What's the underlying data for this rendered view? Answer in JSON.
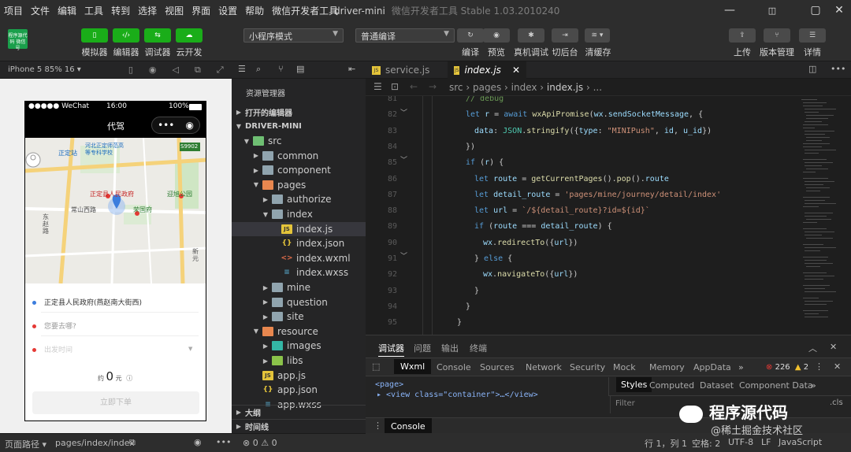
{
  "menu": [
    "项目",
    "文件",
    "编辑",
    "工具",
    "转到",
    "选择",
    "视图",
    "界面",
    "设置",
    "帮助",
    "微信开发者工具"
  ],
  "window": {
    "title": "driver-mini",
    "subtitle": "微信开发者工具 Stable 1.03.2010240"
  },
  "toolbar": {
    "avatar_text": "程序源代码 微信号",
    "left_buttons": [
      {
        "label": "模拟器",
        "icon": "phone-icon"
      },
      {
        "label": "编辑器",
        "icon": "code-icon"
      },
      {
        "label": "调试器",
        "icon": "debug-icon"
      },
      {
        "label": "云开发",
        "icon": "cloud-icon"
      }
    ],
    "mode_select": "小程序模式",
    "compile_select": "普通编译",
    "mid_buttons": [
      {
        "label": "编译",
        "icon": "refresh-icon"
      },
      {
        "label": "预览",
        "icon": "eye-icon"
      },
      {
        "label": "真机调试",
        "icon": "bug-icon"
      },
      {
        "label": "切后台",
        "icon": "switch-icon"
      },
      {
        "label": "清缓存",
        "icon": "layers-icon"
      }
    ],
    "right_buttons": [
      {
        "label": "上传",
        "icon": "upload-icon"
      },
      {
        "label": "版本管理",
        "icon": "branch-icon"
      },
      {
        "label": "详情",
        "icon": "menu-icon"
      }
    ]
  },
  "simulator": {
    "device": "iPhone 5 85% 16 ▾",
    "status_left": "●●●●● WeChat",
    "status_time": "16:00",
    "status_right": "100%",
    "nav_title": "代驾",
    "map_labels": [
      "正定站",
      "河北正定师范高等专科学校",
      "S9902",
      "正定县人民政府",
      "迎旭公园",
      "常山西路",
      "荣国府",
      "东赵路",
      "新元"
    ],
    "start_address": "正定县人民政府(燕赵南大街西)",
    "destination_placeholder": "您要去哪?",
    "time_placeholder": "出发时间",
    "price_prefix": "约",
    "price_value": "0",
    "price_unit": "元",
    "order_button": "立即下单"
  },
  "explorer": {
    "title": "资源管理器",
    "open_editors": "打开的编辑器",
    "project": "DRIVER-MINI",
    "tree": [
      {
        "label": "src",
        "type": "folder-g",
        "depth": 0,
        "open": true
      },
      {
        "label": "common",
        "type": "folder",
        "depth": 1,
        "open": false
      },
      {
        "label": "component",
        "type": "folder",
        "depth": 1,
        "open": false
      },
      {
        "label": "pages",
        "type": "folder-o",
        "depth": 1,
        "open": true
      },
      {
        "label": "authorize",
        "type": "folder",
        "depth": 2,
        "open": false
      },
      {
        "label": "index",
        "type": "folder",
        "depth": 2,
        "open": true
      },
      {
        "label": "index.js",
        "type": "js",
        "depth": 3,
        "selected": true
      },
      {
        "label": "index.json",
        "type": "json",
        "depth": 3
      },
      {
        "label": "index.wxml",
        "type": "wxml",
        "depth": 3
      },
      {
        "label": "index.wxss",
        "type": "wxss",
        "depth": 3
      },
      {
        "label": "mine",
        "type": "folder",
        "depth": 2,
        "open": false
      },
      {
        "label": "question",
        "type": "folder",
        "depth": 2,
        "open": false
      },
      {
        "label": "site",
        "type": "folder",
        "depth": 2,
        "open": false
      },
      {
        "label": "resource",
        "type": "folder-o",
        "depth": 1,
        "open": true
      },
      {
        "label": "images",
        "type": "img",
        "depth": 2,
        "open": false
      },
      {
        "label": "libs",
        "type": "lib",
        "depth": 2,
        "open": false
      },
      {
        "label": "app.js",
        "type": "js",
        "depth": 1
      },
      {
        "label": "app.json",
        "type": "json",
        "depth": 1
      },
      {
        "label": "app.wxss",
        "type": "wxss",
        "depth": 1
      }
    ],
    "outline": "大纲",
    "timeline": "时间线"
  },
  "editor": {
    "tabs": [
      {
        "label": "service.js",
        "active": false
      },
      {
        "label": "index.js",
        "active": true
      }
    ],
    "breadcrumb": [
      "src",
      "pages",
      "index",
      "index.js",
      "..."
    ],
    "lines": [
      {
        "n": "81",
        "html": "<span class='cm'>// debug</span>",
        "indent": 1
      },
      {
        "n": "82",
        "html": "<span class='kw'>let</span> <span class='var'>r</span> = <span class='kw'>await</span> <span class='fn'>wxApiPromise</span>(<span class='var'>wx</span>.<span class='var'>sendSocketMessage</span>, {",
        "indent": 1
      },
      {
        "n": "83",
        "html": "<span class='var'>data</span>: <span class='ob'>JSON</span>.<span class='fn'>stringify</span>({<span class='var'>type</span>: <span class='str'>\"MINIPush\"</span>, <span class='var'>id</span>, <span class='var'>u_id</span>})",
        "indent": 2
      },
      {
        "n": "84",
        "html": "})",
        "indent": 1
      },
      {
        "n": "85",
        "html": "<span class='kw'>if</span> (<span class='var'>r</span>) {",
        "indent": 1
      },
      {
        "n": "86",
        "html": "<span class='kw'>let</span> <span class='var'>route</span> = <span class='fn'>getCurrentPages</span>().<span class='fn'>pop</span>().<span class='var'>route</span>",
        "indent": 2
      },
      {
        "n": "87",
        "html": "<span class='kw'>let</span> <span class='var'>detail_route</span> = <span class='str'>'pages/mine/journey/detail/index'</span>",
        "indent": 2
      },
      {
        "n": "88",
        "html": "<span class='kw'>let</span> <span class='var'>url</span> = <span class='str'>`/${detail_route}?id=${id}`</span>",
        "indent": 2
      },
      {
        "n": "89",
        "html": "<span class='kw'>if</span> (<span class='var'>route</span> === <span class='var'>detail_route</span>) {",
        "indent": 2
      },
      {
        "n": "90",
        "html": "<span class='var'>wx</span>.<span class='fn'>redirectTo</span>({<span class='var'>url</span>})",
        "indent": 3
      },
      {
        "n": "91",
        "html": "} <span class='kw'>else</span> {",
        "indent": 2
      },
      {
        "n": "92",
        "html": "<span class='var'>wx</span>.<span class='fn'>navigateTo</span>({<span class='var'>url</span>})",
        "indent": 3
      },
      {
        "n": "93",
        "html": "}",
        "indent": 2
      },
      {
        "n": "94",
        "html": "}",
        "indent": 1
      },
      {
        "n": "95",
        "html": "}",
        "indent": 0
      }
    ]
  },
  "devtools": {
    "top_tabs": [
      "调试器",
      "问题",
      "输出",
      "终端"
    ],
    "tabs": [
      "Wxml",
      "Console",
      "Sources",
      "Network",
      "Security",
      "Mock",
      "Memory",
      "AppData"
    ],
    "errors": "226",
    "warnings": "2",
    "xml_line1": "<page>",
    "xml_line2": "▸ <view class=\"container\">…</view>",
    "style_tabs": [
      "Styles",
      "Computed",
      "Dataset",
      "Component Data"
    ],
    "filter_placeholder": "Filter",
    "cls": ".cls",
    "console_label": "Console"
  },
  "status": {
    "page_path_label": "页面路径 ▾",
    "page_path": "pages/index/index",
    "errors": "0",
    "warnings": "0",
    "position": "行 1，列 1",
    "spaces": "空格: 2",
    "encoding": "UTF-8",
    "eol": "LF",
    "lang": "JavaScript"
  },
  "watermark": {
    "main": "程序源代码",
    "sub": "@稀土掘金技术社区"
  },
  "colors": {
    "accent": "#1aad19",
    "bg": "#1e1e1e",
    "panel": "#252526",
    "toolbar": "#2d2d2d"
  }
}
